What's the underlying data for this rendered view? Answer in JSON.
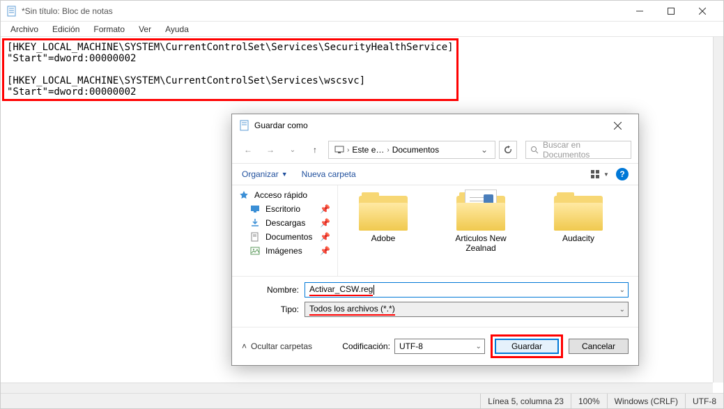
{
  "notepad": {
    "title": "*Sin título: Bloc de notas",
    "menus": [
      "Archivo",
      "Edición",
      "Formato",
      "Ver",
      "Ayuda"
    ],
    "content_line1": "[HKEY_LOCAL_MACHINE\\SYSTEM\\CurrentControlSet\\Services\\SecurityHealthService]",
    "content_line2": "\"Start\"=dword:00000002",
    "content_line3": "[HKEY_LOCAL_MACHINE\\SYSTEM\\CurrentControlSet\\Services\\wscsvc]",
    "content_line4": "\"Start\"=dword:00000002",
    "status": {
      "position": "Línea 5, columna 23",
      "zoom": "100%",
      "lineending": "Windows (CRLF)",
      "encoding": "UTF-8"
    }
  },
  "dialog": {
    "title": "Guardar como",
    "nav": {
      "pc": "Este e…",
      "folder": "Documentos"
    },
    "search_placeholder": "Buscar en Documentos",
    "toolbar": {
      "organize": "Organizar",
      "newfolder": "Nueva carpeta"
    },
    "sidebar": {
      "quickaccess": "Acceso rápido",
      "items": [
        {
          "label": "Escritorio",
          "icon": "desktop"
        },
        {
          "label": "Descargas",
          "icon": "download"
        },
        {
          "label": "Documentos",
          "icon": "document"
        },
        {
          "label": "Imágenes",
          "icon": "image"
        }
      ]
    },
    "folders": [
      {
        "name": "Adobe",
        "type": "plain"
      },
      {
        "name": "Articulos New Zealnad",
        "type": "docs"
      },
      {
        "name": "Audacity",
        "type": "plain"
      }
    ],
    "form": {
      "name_label": "Nombre:",
      "name_value": "Activar_CSW.reg",
      "type_label": "Tipo:",
      "type_value": "Todos los archivos  (*.*)"
    },
    "footer": {
      "hide_folders": "Ocultar carpetas",
      "encoding_label": "Codificación:",
      "encoding_value": "UTF-8",
      "save": "Guardar",
      "cancel": "Cancelar"
    }
  }
}
